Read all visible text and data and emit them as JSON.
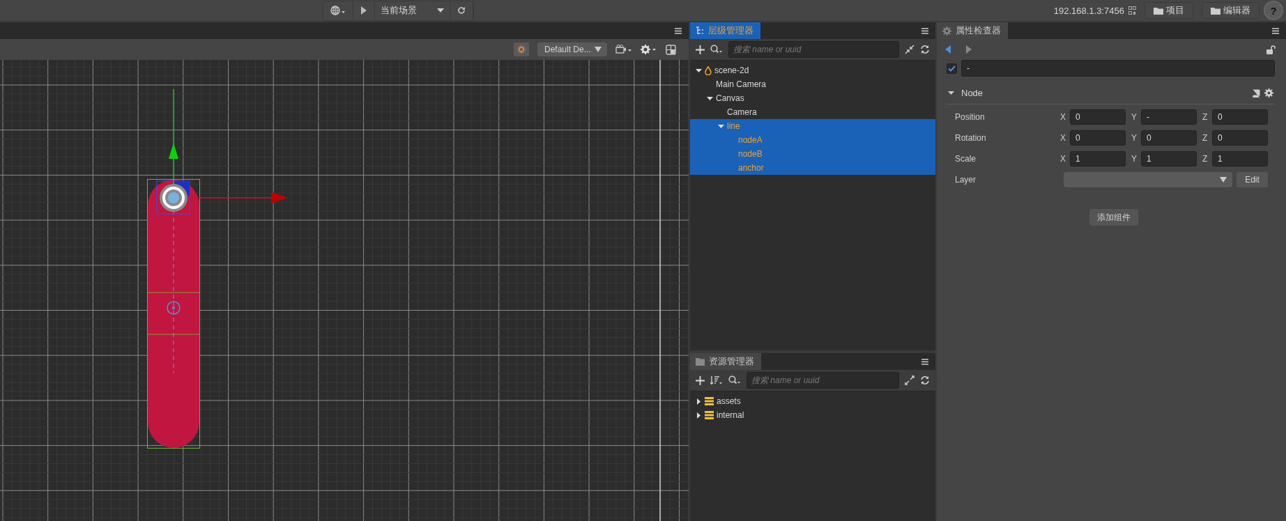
{
  "top_bar": {
    "scene_select": "当前场景",
    "address": "192.168.1.3:7456",
    "buttons": [
      "项目",
      "编辑器"
    ],
    "help": "?"
  },
  "scene": {
    "camera_select": "Default De..."
  },
  "hierarchy": {
    "title": "层级管理器",
    "focused": true,
    "search": {
      "placeholder": "搜索 name or uuid"
    },
    "tree": [
      {
        "label": "scene-2d",
        "kind": "scene",
        "expanded": true,
        "selected": false,
        "children": [
          {
            "label": "Main Camera",
            "selected": false
          },
          {
            "label": "Canvas",
            "expanded": true,
            "selected": false,
            "children": [
              {
                "label": "Camera",
                "selected": false
              },
              {
                "label": "line",
                "expanded": true,
                "selected": true,
                "children": [
                  {
                    "label": "nodeA",
                    "selected": true
                  },
                  {
                    "label": "nodeB",
                    "selected": true
                  },
                  {
                    "label": "anchor",
                    "selected": true
                  }
                ]
              }
            ]
          }
        ]
      }
    ]
  },
  "assets": {
    "title": "资源管理器",
    "focused": false,
    "search": {
      "placeholder": "搜索 name or uuid"
    },
    "items": [
      {
        "label": "assets",
        "expanded": false
      },
      {
        "label": "internal",
        "expanded": false
      }
    ]
  },
  "inspector": {
    "title": "属性检查器",
    "focused": false,
    "node_active": true,
    "node_name": "-",
    "component": {
      "title": "Node",
      "expanded": true,
      "properties": [
        {
          "kind": "vector",
          "label": "Position",
          "fields": [
            {
              "axis": "X",
              "value": "0"
            },
            {
              "axis": "Y",
              "value": "-"
            },
            {
              "axis": "Z",
              "value": "0"
            }
          ]
        },
        {
          "kind": "vector",
          "label": "Rotation",
          "fields": [
            {
              "axis": "X",
              "value": "0"
            },
            {
              "axis": "Y",
              "value": "0"
            },
            {
              "axis": "Z",
              "value": "0"
            }
          ]
        },
        {
          "kind": "vector",
          "label": "Scale",
          "fields": [
            {
              "axis": "X",
              "value": "1"
            },
            {
              "axis": "Y",
              "value": "1"
            },
            {
              "axis": "Z",
              "value": "1"
            }
          ]
        },
        {
          "kind": "select",
          "label": "Layer",
          "button": "Edit"
        }
      ]
    },
    "add_button": "添加组件"
  }
}
